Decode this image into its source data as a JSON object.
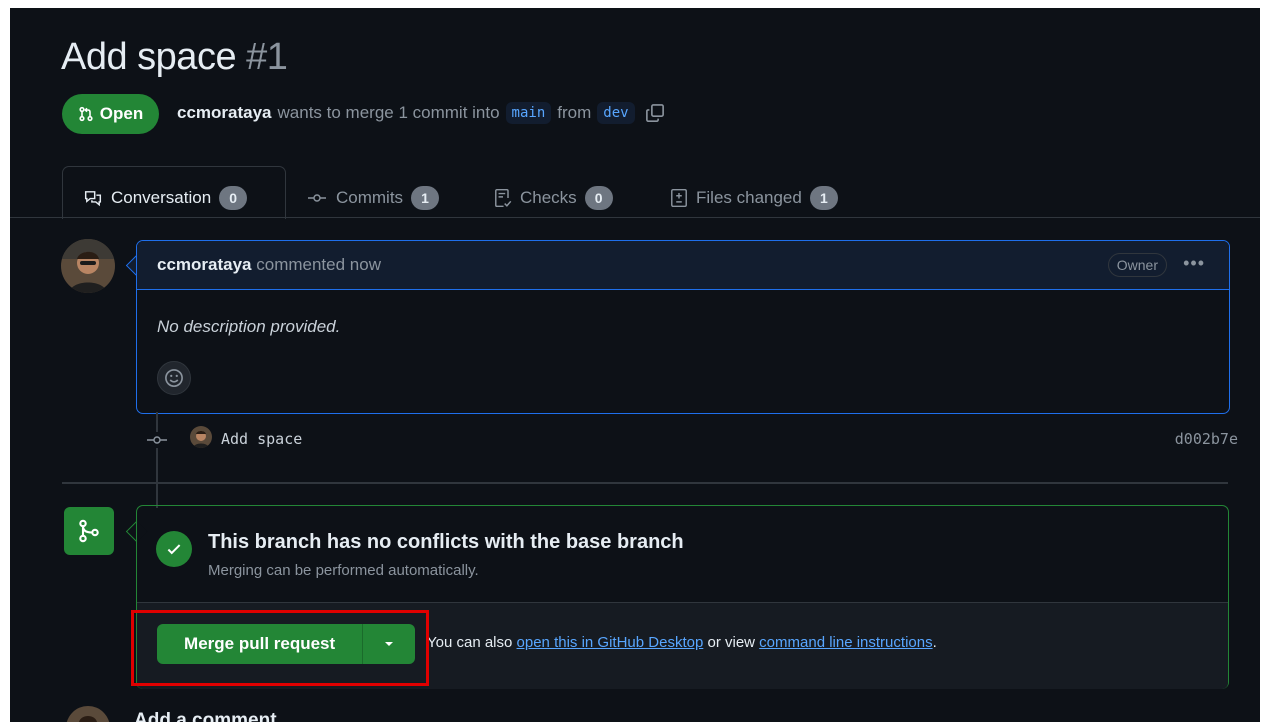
{
  "pr": {
    "title": "Add space",
    "number": "#1",
    "state": "Open",
    "author": "ccmorataya",
    "meta_mid": "wants to merge 1 commit into",
    "base_branch": "main",
    "from_word": "from",
    "head_branch": "dev"
  },
  "tabs": [
    {
      "label": "Conversation",
      "count": "0",
      "icon": "comment-discussion-icon"
    },
    {
      "label": "Commits",
      "count": "1",
      "icon": "git-commit-icon"
    },
    {
      "label": "Checks",
      "count": "0",
      "icon": "checklist-icon"
    },
    {
      "label": "Files changed",
      "count": "1",
      "icon": "file-diff-icon"
    }
  ],
  "comment": {
    "author": "ccmorataya",
    "action": "commented now",
    "role": "Owner",
    "body": "No description provided."
  },
  "commit": {
    "title": "Add space",
    "sha": "d002b7e"
  },
  "merge": {
    "title": "This branch has no conflicts with the base branch",
    "subtitle": "Merging can be performed automatically.",
    "button": "Merge pull request",
    "help_prefix": "You can also",
    "help_link1": "open this in GitHub Desktop",
    "help_mid": "or view",
    "help_link2": "command line instructions",
    "help_suffix": "."
  },
  "add_comment": "Add a comment",
  "colors": {
    "accent_green": "#238636",
    "link_blue": "#58a6ff",
    "highlight_red": "#e00000"
  }
}
